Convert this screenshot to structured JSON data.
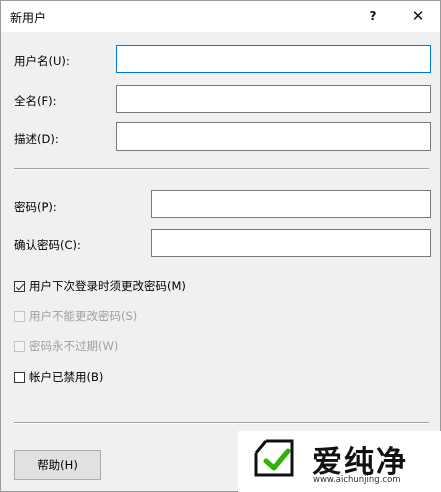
{
  "window": {
    "title": "新用户",
    "help_glyph": "?",
    "close_glyph": "✕"
  },
  "fields": {
    "username": {
      "label": "用户名(U):",
      "value": ""
    },
    "fullname": {
      "label": "全名(F):",
      "value": ""
    },
    "description": {
      "label": "描述(D):",
      "value": ""
    },
    "password": {
      "label": "密码(P):",
      "value": ""
    },
    "confirm_password": {
      "label": "确认密码(C):",
      "value": ""
    }
  },
  "options": {
    "must_change": {
      "label": "用户下次登录时须更改密码(M)",
      "checked": true,
      "enabled": true
    },
    "cannot_change": {
      "label": "用户不能更改密码(S)",
      "checked": false,
      "enabled": false
    },
    "never_expires": {
      "label": "密码永不过期(W)",
      "checked": false,
      "enabled": false
    },
    "disabled": {
      "label": "帐户已禁用(B)",
      "checked": false,
      "enabled": true
    }
  },
  "buttons": {
    "help": "帮助(H)"
  },
  "watermark": {
    "brand": "爱纯净",
    "url": "www.aichunjing.com"
  }
}
